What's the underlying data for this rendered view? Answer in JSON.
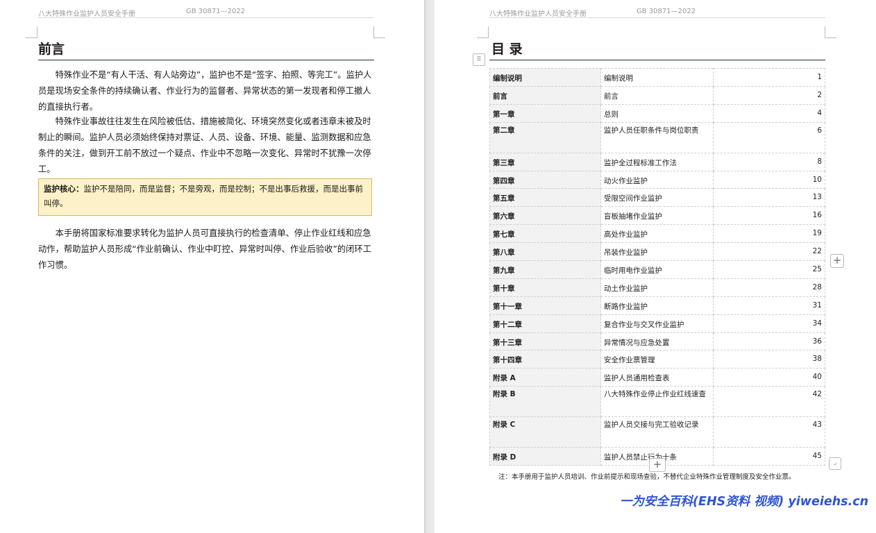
{
  "header": {
    "left_title": "八大特殊作业监护人员安全手册",
    "left_code": "GB 30871—2022",
    "right_title": "八大特殊作业监护人员安全手册",
    "right_code": "GB 30871—2022"
  },
  "preface": {
    "heading": "前言",
    "para1": "特殊作业不是“有人干活、有人站旁边”，监护也不是“签字、拍照、等完工”。监护人员是现场安全条件的持续确认者、作业行为的监督者、异常状态的第一发现者和停工撤人的直接执行者。",
    "para2": "特殊作业事故往往发生在风险被低估、措施被简化、环境突然变化或者违章未被及时制止的瞬间。监护人员必须始终保持对票证、人员、设备、环境、能量、监测数据和应急条件的关注，做到开工前不放过一个疑点、作业中不忽略一次变化、异常时不犹豫一次停工。",
    "note_label": "监护核心：",
    "note_text": "监护不是陪同，而是监督；不是旁观，而是控制；不是出事后救援，而是出事前叫停。",
    "para3": "本手册将国家标准要求转化为监护人员可直接执行的检查清单、停止作业红线和应急动作，帮助监护人员形成“作业前确认、作业中盯控、异常时叫停、作业后验收”的闭环工作习惯。"
  },
  "toc": {
    "heading": "目 录",
    "rows": [
      {
        "section": "编制说明",
        "title": "编制说明",
        "page": "1"
      },
      {
        "section": "前言",
        "title": "前言",
        "page": "2"
      },
      {
        "section": "第一章",
        "title": "总则",
        "page": "4"
      },
      {
        "section": "第二章",
        "title": "监护人员任职条件与岗位职责",
        "page": "6"
      },
      {
        "section": "第三章",
        "title": "监护全过程标准工作法",
        "page": "8"
      },
      {
        "section": "第四章",
        "title": "动火作业监护",
        "page": "10"
      },
      {
        "section": "第五章",
        "title": "受限空间作业监护",
        "page": "13"
      },
      {
        "section": "第六章",
        "title": "盲板抽堵作业监护",
        "page": "16"
      },
      {
        "section": "第七章",
        "title": "高处作业监护",
        "page": "19"
      },
      {
        "section": "第八章",
        "title": "吊装作业监护",
        "page": "22"
      },
      {
        "section": "第九章",
        "title": "临时用电作业监护",
        "page": "25"
      },
      {
        "section": "第十章",
        "title": "动土作业监护",
        "page": "28"
      },
      {
        "section": "第十一章",
        "title": "断路作业监护",
        "page": "31"
      },
      {
        "section": "第十二章",
        "title": "复合作业与交叉作业监护",
        "page": "34"
      },
      {
        "section": "第十三章",
        "title": "异常情况与应急处置",
        "page": "36"
      },
      {
        "section": "第十四章",
        "title": "安全作业票管理",
        "page": "38"
      },
      {
        "section": "附录 A",
        "title": "监护人员通用检查表",
        "page": "40"
      },
      {
        "section": "附录 B",
        "title": "八大特殊作业停止作业红线速查",
        "page": "42"
      },
      {
        "section": "附录 C",
        "title": "监护人员交接与完工验收记录",
        "page": "43"
      },
      {
        "section": "附录 D",
        "title": "监护人员禁止行为十条",
        "page": "45"
      }
    ],
    "footnote": "注：本手册用于监护人员培训、作业前提示和现场查验，不替代企业特殊作业管理制度及安全作业票。"
  },
  "watermark": "一为安全百科(EHS资料 视频) yiweiehs.cn",
  "icons": {
    "drag": "drag-handle-icon",
    "add_row": "plus-icon",
    "add_col": "plus-icon",
    "resize": "resize-icon"
  }
}
